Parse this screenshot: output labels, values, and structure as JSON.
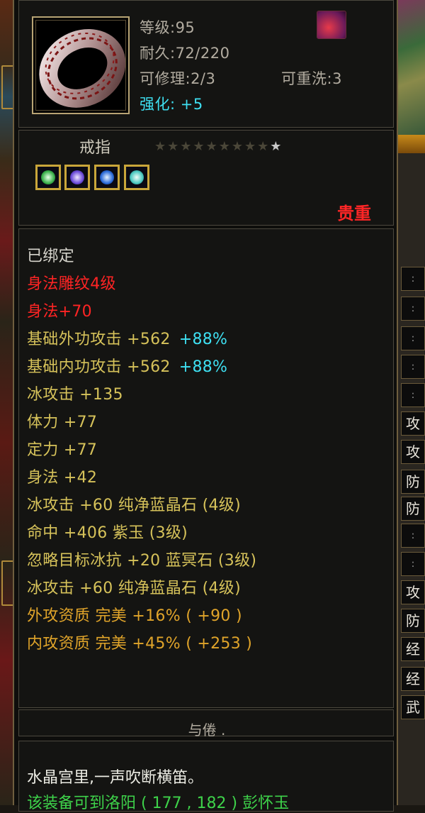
{
  "item": {
    "icon": "ring-icon",
    "level": "等级:95",
    "durability": "耐久:72/220",
    "repairable": "可修理:2/3",
    "rewashable": "可重洗:3",
    "enhance_label": "强化:",
    "enhance_value": "+5",
    "name": "戒指",
    "stars_total": 10,
    "stars_lit": 1,
    "rarity": "贵重",
    "gems": [
      "green-gem-icon",
      "purple-gem-icon",
      "blue-gem-icon",
      "cyan-gem-icon"
    ],
    "corner_badge": "school-badge-icon"
  },
  "attributes": [
    {
      "text": "已绑定",
      "color": "white"
    },
    {
      "text": "身法雕纹4级",
      "color": "red"
    },
    {
      "text": "身法+70",
      "color": "red"
    },
    {
      "text": "基础外功攻击  +562",
      "extra": "+88%",
      "color": "yellow"
    },
    {
      "text": "基础内功攻击  +562",
      "extra": "+88%",
      "color": "yellow"
    },
    {
      "text": "冰攻击  +135",
      "color": "yellow"
    },
    {
      "text": "体力  +77",
      "color": "yellow"
    },
    {
      "text": "定力  +77",
      "color": "yellow"
    },
    {
      "text": "身法  +42",
      "color": "yellow"
    },
    {
      "text": "冰攻击  +60  纯净蓝晶石 (4级)",
      "color": "yellow"
    },
    {
      "text": "命中  +406  紫玉 (3级)",
      "color": "yellow"
    },
    {
      "text": "忽略目标冰抗  +20  蓝冥石 (3级)",
      "color": "yellow"
    },
    {
      "text": "冰攻击  +60  纯净蓝晶石 (4级)",
      "color": "yellow"
    },
    {
      "text": "外攻资质   完美  +16% ( +90 )",
      "color": "orange"
    },
    {
      "text": "内攻资质   完美  +45% ( +253 )",
      "color": "orange"
    }
  ],
  "set_title": "与倦 .",
  "description": {
    "line1": "水晶宫里,一声吹断横笛。",
    "line2": "该装备可到洛阳 ( 177 , 182 ) 彭怀玉"
  },
  "right_panel": {
    "cells": [
      ":",
      ":",
      ":",
      ":",
      ":",
      "攻",
      "攻",
      "防",
      "防",
      ":",
      ":",
      "攻",
      "防",
      "经",
      "经",
      "武"
    ]
  },
  "colors": {
    "red": "#ff2424",
    "orange": "#ff7a14",
    "yellow": "#d6c25a",
    "cyan": "#3ee0f2",
    "white": "#d6d4cc"
  }
}
